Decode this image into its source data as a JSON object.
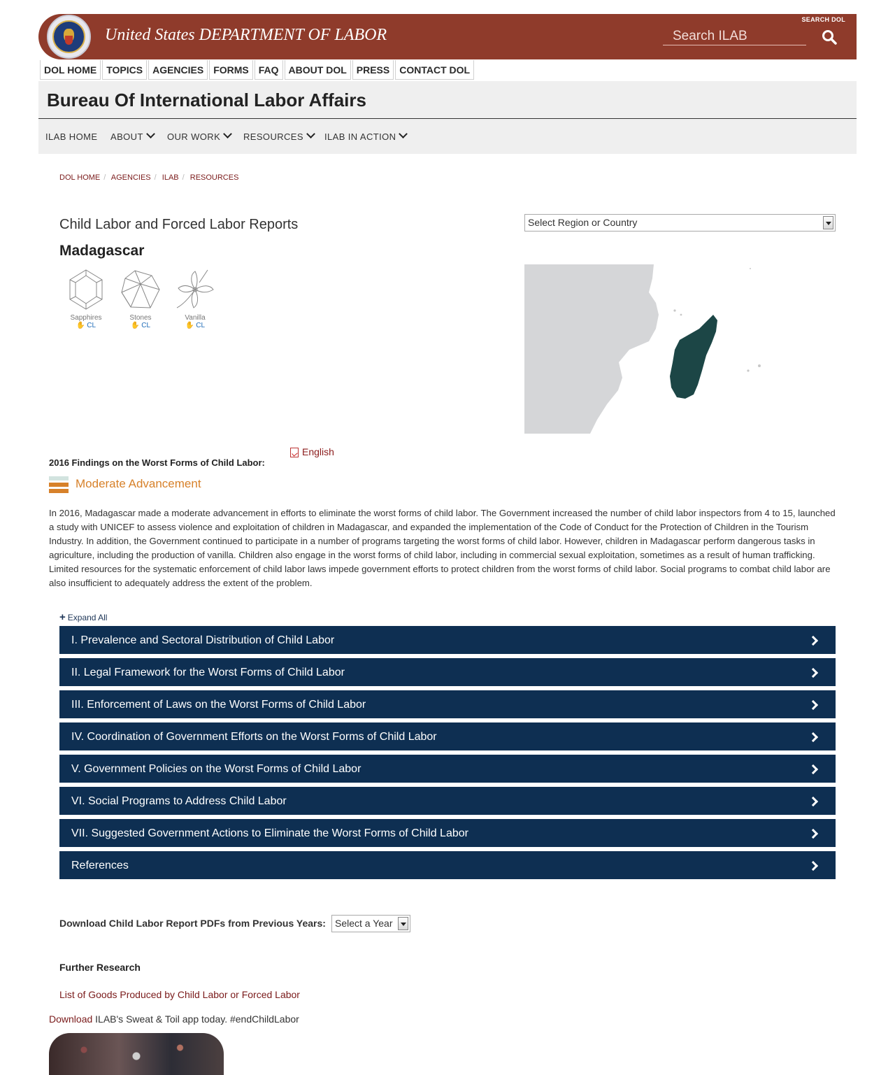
{
  "header": {
    "title": "United States DEPARTMENT OF LABOR",
    "search_label": "SEARCH DOL",
    "search_placeholder": "Search ILAB"
  },
  "top_nav": [
    "DOL HOME",
    "TOPICS",
    "AGENCIES",
    "FORMS",
    "FAQ",
    "ABOUT DOL",
    "PRESS",
    "CONTACT DOL"
  ],
  "bureau": {
    "title": "Bureau Of International Labor Affairs",
    "nav": {
      "home": "ILAB HOME",
      "about": "ABOUT",
      "our_work": "OUR WORK",
      "resources": "RESOURCES",
      "in_action": "ILAB IN ACTION"
    }
  },
  "breadcrumb": [
    "DOL HOME",
    "AGENCIES",
    "ILAB",
    "RESOURCES"
  ],
  "page": {
    "title": "Child Labor and Forced Labor Reports",
    "country": "Madagascar",
    "region_select": "Select Region or Country"
  },
  "goods": [
    {
      "name": "Sapphires",
      "tag": "CL",
      "icon": "gem-icon"
    },
    {
      "name": "Stones",
      "tag": "CL",
      "icon": "stone-icon"
    },
    {
      "name": "Vanilla",
      "tag": "CL",
      "icon": "vanilla-flower-icon"
    }
  ],
  "findings": {
    "label": "2016 Findings on the Worst Forms of Child Labor:",
    "pdf_link": "English",
    "assessment": "Moderate Advancement",
    "assessment_color": "#d7812a",
    "summary": "In 2016, Madagascar made a moderate advancement in efforts to eliminate the worst forms of child labor. The Government increased the number of child labor inspectors from 4 to 15, launched a study with UNICEF to assess violence and exploitation of children in Madagascar, and expanded the implementation of the Code of Conduct for the Protection of Children in the Tourism Industry. In addition, the Government continued to participate in a number of programs targeting the worst forms of child labor. However, children in Madagascar perform dangerous tasks in agriculture, including the production of vanilla. Children also engage in the worst forms of child labor, including in commercial sexual exploitation, sometimes as a result of human trafficking. Limited resources for the systematic enforcement of child labor laws impede government efforts to protect children from the worst forms of child labor. Social programs to combat child labor are also insufficient to adequately address the extent of the problem."
  },
  "sections": {
    "expand_all": "Expand All",
    "items": [
      "I. Prevalence and Sectoral Distribution of Child Labor",
      "II. Legal Framework for the Worst Forms of Child Labor",
      "III. Enforcement of Laws on the Worst Forms of Child Labor",
      "IV. Coordination of Government Efforts on the Worst Forms of Child Labor",
      "V. Government Policies on the Worst Forms of Child Labor",
      "VI. Social Programs to Address Child Labor",
      "VII. Suggested Government Actions to Eliminate the Worst Forms of Child Labor",
      "References"
    ]
  },
  "downloads": {
    "label": "Download Child Labor Report PDFs from Previous Years:",
    "year_select": "Select a Year"
  },
  "further": {
    "title": "Further Research",
    "goods_link": "List of Goods Produced by Child Labor or Forced Labor",
    "app_link": "Download",
    "app_text": " ILAB's Sweat & Toil app today. #endChildLabor"
  },
  "colors": {
    "header_bg": "#8f3b2b",
    "accordion_bg": "#0e2f52",
    "map_land": "#d5d6d8",
    "map_country": "#1c4646"
  }
}
